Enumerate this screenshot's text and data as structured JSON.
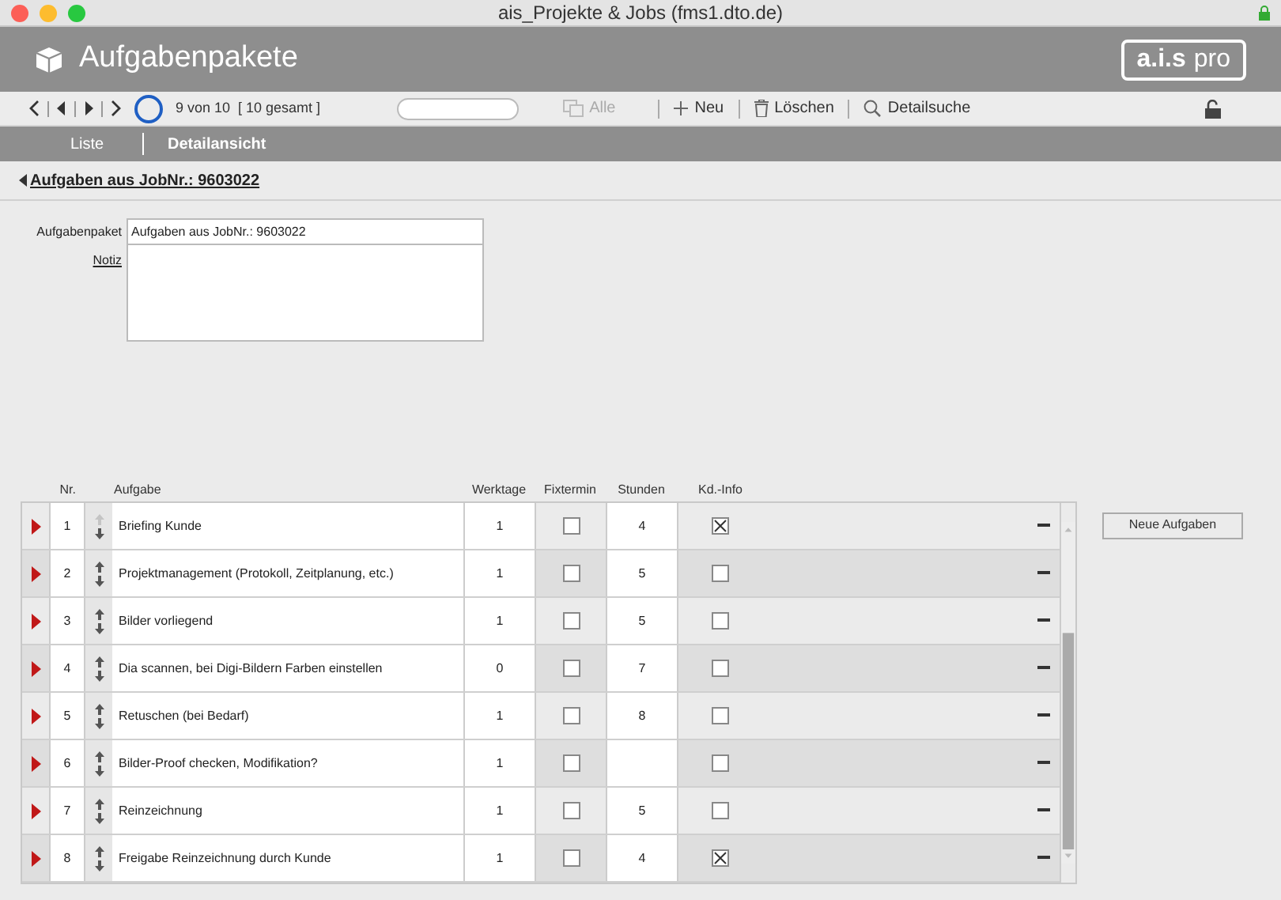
{
  "window": {
    "title": "ais_Projekte & Jobs (fms1.dto.de)"
  },
  "header": {
    "title": "Aufgabenpakete",
    "logo": {
      "brand": "a.i.s",
      "edition": "pro"
    }
  },
  "toolbar": {
    "record_count": "9 von 10  [ 10 gesamt ]",
    "buttons": [
      {
        "kind": "copy",
        "label": "Alle",
        "disabled": true
      },
      {
        "kind": "plus",
        "label": "Neu",
        "disabled": false
      },
      {
        "kind": "trash",
        "label": "Löschen",
        "disabled": false
      },
      {
        "kind": "search",
        "label": "Detailsuche",
        "disabled": false
      }
    ]
  },
  "tabs": [
    {
      "label": "Liste",
      "selected": false
    },
    {
      "label": "Detailansicht",
      "selected": true
    }
  ],
  "breadcrumb": "Aufgaben aus JobNr.: 9603022",
  "form": {
    "fields": [
      {
        "label": "Aufgabenpaket",
        "value": "Aufgaben aus JobNr.: 9603022"
      }
    ],
    "note_label": "Notiz"
  },
  "table": {
    "columns": [
      "Nr.",
      "Aufgabe",
      "Werktage",
      "Fixtermin",
      "Stunden",
      "Kd.-Info"
    ],
    "rows": [
      {
        "nr": "1",
        "task": "Briefing Kunde",
        "days": "1",
        "fixed": false,
        "hours": "4",
        "info": true,
        "can_move_up": false
      },
      {
        "nr": "2",
        "task": "Projektmanagement (Protokoll, Zeitplanung, etc.)",
        "days": "1",
        "fixed": false,
        "hours": "5",
        "info": false,
        "can_move_up": true
      },
      {
        "nr": "3",
        "task": "Bilder vorliegend",
        "days": "1",
        "fixed": false,
        "hours": "5",
        "info": false,
        "can_move_up": true
      },
      {
        "nr": "4",
        "task": "Dia scannen, bei Digi-Bildern Farben einstellen",
        "days": "0",
        "fixed": false,
        "hours": "7",
        "info": false,
        "can_move_up": true
      },
      {
        "nr": "5",
        "task": "Retuschen (bei Bedarf)",
        "days": "1",
        "fixed": false,
        "hours": "8",
        "info": false,
        "can_move_up": true
      },
      {
        "nr": "6",
        "task": "Bilder-Proof checken, Modifikation?",
        "days": "1",
        "fixed": false,
        "hours": "",
        "info": false,
        "can_move_up": true
      },
      {
        "nr": "7",
        "task": "Reinzeichnung",
        "days": "1",
        "fixed": false,
        "hours": "5",
        "info": false,
        "can_move_up": true
      },
      {
        "nr": "8",
        "task": "Freigabe Reinzeichnung durch Kunde",
        "days": "1",
        "fixed": false,
        "hours": "4",
        "info": true,
        "can_move_up": true
      }
    ]
  },
  "side_button": "Neue Aufgaben"
}
